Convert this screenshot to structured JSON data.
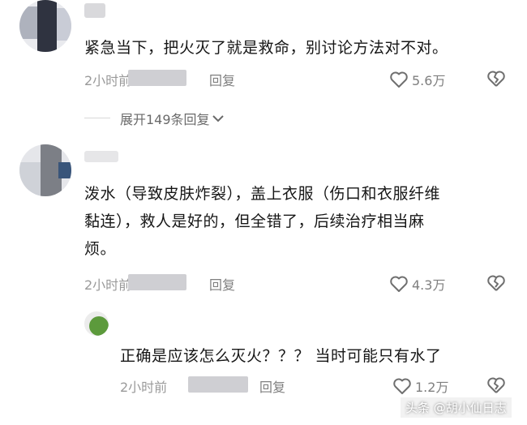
{
  "comments": [
    {
      "text": "紧急当下，把火灭了就是救命，别讨论方法对不对。",
      "time": "2小时前",
      "reply_label": "回复",
      "likes": "5.6万",
      "like_icon": "heart-icon",
      "dislike_icon": "broken-heart-icon"
    },
    {
      "text_line1": "泼水（导致皮肤炸裂），盖上衣服（伤口和衣服纤维",
      "text_line2": "黏连），救人是好的，但全错了，后续治疗相当麻",
      "text_line3": "烦。",
      "time": "2小时前",
      "reply_label": "回复",
      "likes": "4.3万",
      "like_icon": "heart-icon",
      "dislike_icon": "broken-heart-icon"
    }
  ],
  "expand_replies": {
    "label": "展开149条回复",
    "icon": "chevron-down-icon"
  },
  "reply": {
    "text": "正确是应该怎么灭火？？？  当时可能只有水了",
    "time": "2小时前",
    "reply_label": "回复",
    "likes": "1.2万",
    "like_icon": "heart-icon",
    "dislike_icon": "broken-heart-icon"
  },
  "watermark": "头条 @胡小仙日志"
}
